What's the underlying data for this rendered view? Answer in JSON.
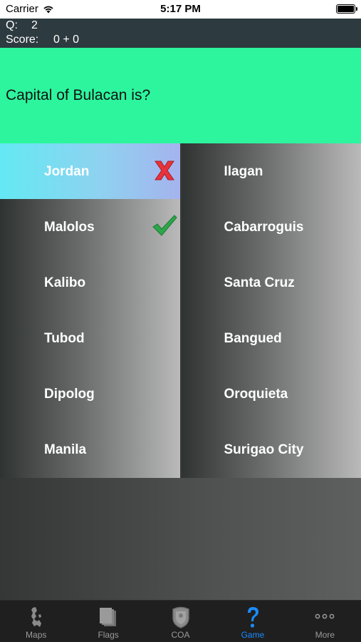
{
  "status_bar": {
    "carrier": "Carrier",
    "time": "5:17 PM"
  },
  "header": {
    "q_label": "Q:",
    "q_value": "2",
    "score_label": "Score:",
    "score_value": "0 + 0"
  },
  "question": {
    "text": "Capital of Bulacan is?"
  },
  "answers": {
    "left": [
      "Jordan",
      "Malolos",
      "Kalibo",
      "Tubod",
      "Dipolog",
      "Manila"
    ],
    "right": [
      "Ilagan",
      "Cabarroguis",
      "Santa Cruz",
      "Bangued",
      "Oroquieta",
      "Surigao City"
    ],
    "selected": "Jordan",
    "correct": "Malolos"
  },
  "tab_bar": {
    "tabs": [
      {
        "label": "Maps",
        "icon": "map-icon"
      },
      {
        "label": "Flags",
        "icon": "flags-icon"
      },
      {
        "label": "COA",
        "icon": "coat-of-arms-icon"
      },
      {
        "label": "Game",
        "icon": "question-icon"
      },
      {
        "label": "More",
        "icon": "more-icon"
      }
    ],
    "active": "Game"
  },
  "colors": {
    "question_bg": "#2df59e",
    "active_tab": "#1a8cff",
    "wrong_mark": "#e8323c",
    "correct_mark": "#2ca64a"
  }
}
